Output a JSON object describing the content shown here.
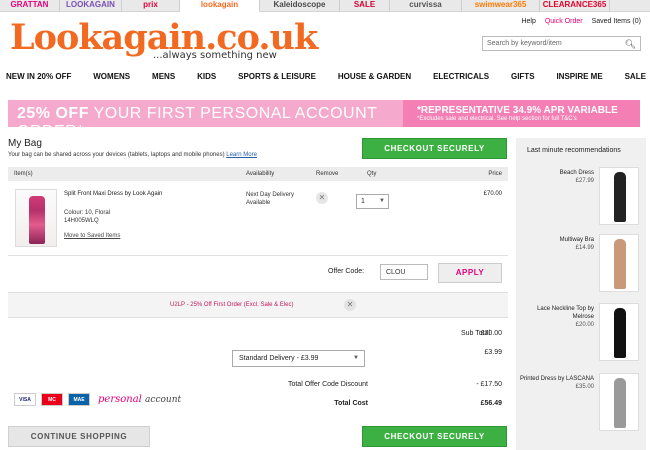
{
  "brands": [
    {
      "label": "GRATTAN",
      "color": "#e4007d",
      "width": 60
    },
    {
      "label": "LOOKAGAIN",
      "color": "#7a4fb5",
      "width": 62
    },
    {
      "label": "prix",
      "color": "#e3003b",
      "width": 58
    },
    {
      "label": "lookagain",
      "color": "#f26a21",
      "width": 80,
      "active": true
    },
    {
      "label": "Kaleidoscope",
      "color": "#4a4a4a",
      "width": 80
    },
    {
      "label": "SALE",
      "color": "#d50032",
      "width": 50
    },
    {
      "label": "curvissa",
      "color": "#555555",
      "width": 72
    },
    {
      "label": "swimwear365",
      "color": "#ff7a00",
      "width": 78
    },
    {
      "label": "CLEARANCE365",
      "color": "#e4002b",
      "width": 70
    }
  ],
  "header": {
    "logo": "Lookagain.co.uk",
    "tagline": "...always something new",
    "utility": {
      "help": "Help",
      "quick_order": "Quick Order",
      "saved": "Saved Items (0)"
    },
    "search_placeholder": "Search by keyword/item"
  },
  "nav": [
    "NEW IN 20% OFF",
    "WOMENS",
    "MENS",
    "KIDS",
    "SPORTS & LEISURE",
    "HOUSE & GARDEN",
    "ELECTRICALS",
    "GIFTS",
    "INSPIRE ME",
    "SALE"
  ],
  "promo": {
    "bold": "25% OFF",
    "text": " YOUR FIRST PERSONAL ACCOUNT ORDER*",
    "right_big": "*REPRESENTATIVE 34.9% APR VARIABLE",
    "right_small": "*Excludes sale and electrical. See help section for full T&C's"
  },
  "bag": {
    "title": "My Bag",
    "note": "Your bag can be shared across your devices (tablets, laptops and mobile phones)",
    "learn_more": "Learn More",
    "checkout": "CHECKOUT SECURELY",
    "continue": "CONTINUE SHOPPING"
  },
  "table": {
    "headers": {
      "item": "Item(s)",
      "availability": "Availability",
      "remove": "Remove",
      "qty": "Qty",
      "price": "Price"
    },
    "item": {
      "name": "Split Front Maxi Dress by Look Again",
      "colour": "Colour: 10, Floral",
      "code": "14H005WLQ",
      "move": "Move to Saved Items",
      "availability_1": "Next Day Delivery",
      "availability_2": "Available",
      "qty": "1",
      "price": "£70.00"
    }
  },
  "offer": {
    "label": "Offer Code:",
    "value": "CLOU",
    "apply": "APPLY",
    "applied_text": "U2LP - 25% Off First Order (Excl. Sale & Elec)"
  },
  "summary": {
    "subtotal_label": "Sub Total",
    "subtotal": "£70.00",
    "delivery_value": "£3.99",
    "delivery_option": "Standard Delivery - £3.99",
    "discount_label": "Total Offer Code Discount",
    "discount": "- £17.50",
    "total_label": "Total Cost",
    "total": "£56.49"
  },
  "payment": {
    "cards": [
      "VISA",
      "MC",
      "MAE"
    ],
    "personal": "personal",
    "account": "account"
  },
  "recommendations": {
    "title": "Last minute recommendations",
    "items": [
      {
        "name": "Beach Dress",
        "price": "£27.99",
        "color": "#222222"
      },
      {
        "name": "Multiway Bra",
        "price": "£14.99",
        "color": "#1a1a1a"
      },
      {
        "name": "Lace Neckline Top by Melrose",
        "price": "£20.00",
        "color": "#111111"
      },
      {
        "name": "Printed Dress by LASCANA",
        "price": "£35.00",
        "color": "#8a8a8a"
      }
    ]
  }
}
